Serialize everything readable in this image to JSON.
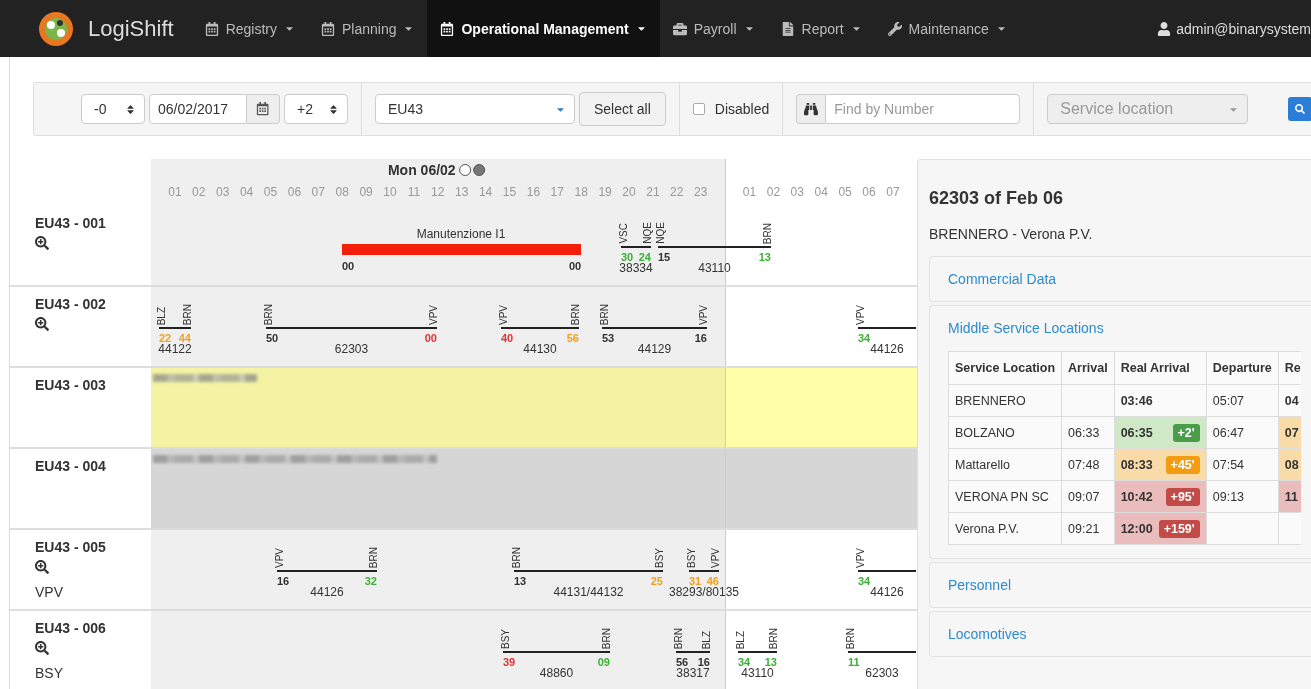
{
  "brand": "LogiShift",
  "nav": {
    "items": [
      {
        "label": "Registry",
        "selected": false
      },
      {
        "label": "Planning",
        "selected": false
      },
      {
        "label": "Operational Management",
        "selected": true
      },
      {
        "label": "Payroll",
        "selected": false
      },
      {
        "label": "Report",
        "selected": false
      },
      {
        "label": "Maintenance",
        "selected": false
      }
    ],
    "user": "admin@binarysystem"
  },
  "toolbar": {
    "offset_before": "-0",
    "date": "06/02/2017",
    "offset_after": "+2",
    "line": "EU43",
    "select_all": "Select all",
    "disabled": {
      "label": "Disabled",
      "checked": false
    },
    "search": {
      "placeholder": "Find by Number"
    },
    "service_location": {
      "placeholder": "Service location"
    }
  },
  "timeline": {
    "days": [
      {
        "label": "Mon 06/02",
        "hours": [
          "01",
          "02",
          "03",
          "04",
          "05",
          "06",
          "07",
          "08",
          "09",
          "10",
          "11",
          "12",
          "13",
          "14",
          "15",
          "16",
          "17",
          "18",
          "19",
          "20",
          "21",
          "22",
          "23"
        ]
      },
      {
        "hours": [
          "01",
          "02",
          "03",
          "04",
          "05",
          "06",
          "07"
        ]
      }
    ]
  },
  "rows": [
    {
      "name": "EU43 - 001",
      "kind": "normal",
      "maintenance": {
        "label": "Manutenzione I1",
        "start": "00",
        "end": "00"
      },
      "segments": [
        {
          "from": "VSC",
          "to": "NQE",
          "dep": {
            "text": "30",
            "color": "#3cb034"
          },
          "arr": {
            "text": "24",
            "color": "#3cb034"
          },
          "train": "38334"
        },
        {
          "from": "NQE",
          "to": "BRN",
          "dep": {
            "text": "15",
            "color": "#333333"
          },
          "arr": {
            "text": "13",
            "color": "#3cb034"
          },
          "train": "43110"
        }
      ]
    },
    {
      "name": "EU43 - 002",
      "kind": "normal",
      "segments": [
        {
          "from": "BLZ",
          "to": "BRN",
          "dep": {
            "text": "22",
            "color": "#f0a020"
          },
          "arr": {
            "text": "44",
            "color": "#f0a020"
          },
          "train": "44122"
        },
        {
          "from": "BRN",
          "to": "VPV",
          "dep": {
            "text": "50",
            "color": "#333333"
          },
          "arr": {
            "text": "00",
            "color": "#e53030"
          },
          "train": "62303"
        },
        {
          "from": "VPV",
          "to": "BRN",
          "dep": {
            "text": "40",
            "color": "#e53030"
          },
          "arr": {
            "text": "56",
            "color": "#f0a020"
          },
          "train": "44130"
        },
        {
          "from": "BRN",
          "to": "VPV",
          "dep": {
            "text": "53",
            "color": "#333333"
          },
          "arr": {
            "text": "16",
            "color": "#333333"
          },
          "train": "44129"
        },
        {
          "from": "VPV",
          "dep": {
            "text": "34",
            "color": "#3cb034"
          },
          "train": "44126"
        }
      ]
    },
    {
      "name": "EU43 - 003",
      "kind": "reserved",
      "segments": []
    },
    {
      "name": "EU43 - 004",
      "kind": "unavailable",
      "segments": []
    },
    {
      "name": "EU43 - 005",
      "kind": "normal",
      "location": "VPV",
      "segments": [
        {
          "from": "VPV",
          "to": "BRN",
          "dep": {
            "text": "16",
            "color": "#333333"
          },
          "arr": {
            "text": "32",
            "color": "#3cb034"
          },
          "train": "44126"
        },
        {
          "from": "BRN",
          "to": "BSY",
          "dep": {
            "text": "13",
            "color": "#333333"
          },
          "arr": {
            "text": "25",
            "color": "#f0a020"
          },
          "train": "44131/44132"
        },
        {
          "from": "BSY",
          "to": "VPV",
          "dep": {
            "text": "31",
            "color": "#f0a020"
          },
          "arr": {
            "text": "46",
            "color": "#f0a020"
          },
          "train": "38293/80135"
        },
        {
          "from": "VPV",
          "dep": {
            "text": "34",
            "color": "#3cb034"
          },
          "train": "44126"
        }
      ]
    },
    {
      "name": "EU43 - 006",
      "kind": "normal",
      "location": "BSY",
      "segments": [
        {
          "from": "BSY",
          "to": "BRN",
          "dep": {
            "text": "39",
            "color": "#e53030"
          },
          "arr": {
            "text": "09",
            "color": "#3cb034"
          },
          "train": "48860"
        },
        {
          "from": "BRN",
          "to": "BLZ",
          "dep": {
            "text": "56",
            "color": "#333333"
          },
          "arr": {
            "text": "16",
            "color": "#333333"
          },
          "train": "38317"
        },
        {
          "from": "BLZ",
          "to": "BRN",
          "dep": {
            "text": "34",
            "color": "#3cb034"
          },
          "arr": {
            "text": "13",
            "color": "#3cb034"
          },
          "train": "43110"
        },
        {
          "from": "BRN",
          "dep": {
            "text": "11",
            "color": "#3cb034"
          },
          "train": "62303"
        }
      ]
    }
  ],
  "popup": {
    "title": "62303 of Feb 06",
    "route": "BRENNERO - Verona P.V.",
    "sections": [
      {
        "title": "Commercial Data"
      },
      {
        "title": "Middle Service Locations",
        "table": {
          "columns": [
            "Service Location",
            "Arrival",
            "Real Arrival",
            "Departure",
            "Re"
          ],
          "rows": [
            {
              "location": "BRENNERO",
              "real_arrival": {
                "text": "03:46"
              },
              "departure": "05:07",
              "real_departure": {
                "text": "04"
              }
            },
            {
              "location": "BOLZANO",
              "arrival": "06:33",
              "real_arrival": {
                "text": "06:35",
                "color": "#cfe8c6"
              },
              "delay": {
                "text": "+2'",
                "color": "#4a9b4a"
              },
              "departure": "06:47",
              "real_departure": {
                "text": "07",
                "color": "#f9dba8"
              }
            },
            {
              "location": "Mattarello",
              "arrival": "07:48",
              "real_arrival": {
                "text": "08:33",
                "color": "#f9dba8"
              },
              "delay": {
                "text": "+45'",
                "color": "#f39c12"
              },
              "departure": "07:54",
              "real_departure": {
                "text": "08",
                "color": "#f9dba8"
              }
            },
            {
              "location": "VERONA PN SC",
              "arrival": "09:07",
              "real_arrival": {
                "text": "10:42",
                "color": "#ebbcbc"
              },
              "delay": {
                "text": "+95'",
                "color": "#c24b47"
              },
              "departure": "09:13",
              "real_departure": {
                "text": "11",
                "color": "#ebbcbc"
              }
            },
            {
              "location": "Verona P.V.",
              "arrival": "09:21",
              "real_arrival": {
                "text": "12:00",
                "color": "#ebbcbc"
              },
              "delay": {
                "text": "+159'",
                "color": "#c24b47"
              }
            }
          ]
        }
      },
      {
        "title": "Personnel"
      },
      {
        "title": "Locomotives"
      }
    ]
  }
}
